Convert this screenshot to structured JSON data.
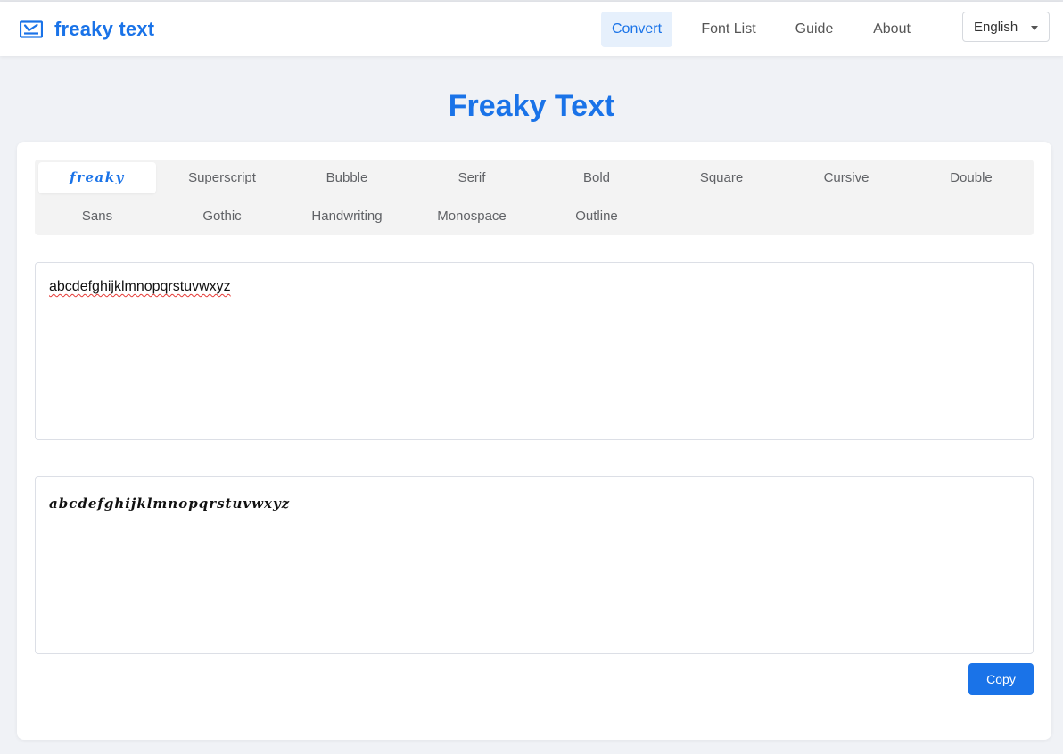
{
  "header": {
    "brand": "freaky text",
    "nav": [
      {
        "label": "Convert",
        "active": true
      },
      {
        "label": "Font List",
        "active": false
      },
      {
        "label": "Guide",
        "active": false
      },
      {
        "label": "About",
        "active": false
      }
    ],
    "language": "English"
  },
  "page": {
    "title": "Freaky Text"
  },
  "tabs": [
    {
      "label": "freaky",
      "active": true
    },
    {
      "label": "Superscript"
    },
    {
      "label": "Bubble"
    },
    {
      "label": "Serif"
    },
    {
      "label": "Bold"
    },
    {
      "label": "Square"
    },
    {
      "label": "Cursive"
    },
    {
      "label": "Double"
    },
    {
      "label": "Sans"
    },
    {
      "label": "Gothic"
    },
    {
      "label": "Handwriting"
    },
    {
      "label": "Monospace"
    },
    {
      "label": "Outline"
    }
  ],
  "input": {
    "value": "abcdefghijklmnopqrstuvwxyz"
  },
  "output": {
    "value": "abcdefghijklmnopqrstuvwxyz"
  },
  "actions": {
    "copy_label": "Copy"
  },
  "colors": {
    "accent": "#1a73e8",
    "page_bg": "#f0f2f6",
    "active_nav_bg": "#e6f0fc"
  },
  "icons": {
    "brand": "envelope-check-icon",
    "language": "caret-down-icon"
  }
}
